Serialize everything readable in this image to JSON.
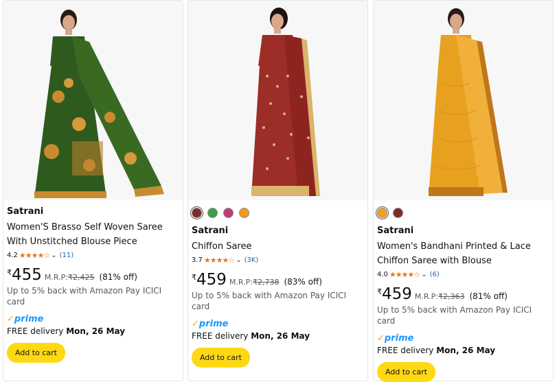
{
  "products": [
    {
      "brand": "Satrani",
      "title_line1": "Women'S Brasso Self Woven Saree",
      "title_line2": "With Unstitched Blouse Piece",
      "rating": "4.2",
      "stars": "★★★★☆",
      "review_count": "(11)",
      "currency": "₹",
      "price": "455",
      "mrp_label": "M.R.P:",
      "mrp": "₹2,425",
      "discount": "(81% off)",
      "cashback": "Up to 5% back with Amazon Pay ICICI card",
      "prime_label": "prime",
      "delivery_prefix": "FREE delivery",
      "delivery_date": "Mon, 26 May",
      "cart_label": "Add to cart",
      "swatches": [],
      "image_colors": [
        "#2f5a1e",
        "#c98b2e"
      ]
    },
    {
      "brand": "Satrani",
      "title_line1": "Chiffon Saree",
      "title_line2": "",
      "rating": "3.7",
      "stars": "★★★★☆",
      "review_count": "(3K)",
      "currency": "₹",
      "price": "459",
      "mrp_label": "M.R.P:",
      "mrp": "₹2,738",
      "discount": "(83% off)",
      "cashback": "Up to 5% back with Amazon Pay ICICI card",
      "prime_label": "prime",
      "delivery_prefix": "FREE delivery",
      "delivery_date": "Mon, 26 May",
      "cart_label": "Add to cart",
      "swatches": [
        "#7b2c2c",
        "#3f9e4d",
        "#c23b77",
        "#f59a1a"
      ],
      "image_colors": [
        "#9c2d27",
        "#d9b46a"
      ]
    },
    {
      "brand": "Satrani",
      "title_line1": "Women's Bandhani Printed & Lace",
      "title_line2": "Chiffon Saree with Blouse",
      "rating": "4.0",
      "stars": "★★★★☆",
      "review_count": "(6)",
      "currency": "₹",
      "price": "459",
      "mrp_label": "M.R.P:",
      "mrp": "₹2,363",
      "discount": "(81% off)",
      "cashback": "Up to 5% back with Amazon Pay ICICI card",
      "prime_label": "prime",
      "delivery_prefix": "FREE delivery",
      "delivery_date": "Mon, 26 May",
      "cart_label": "Add to cart",
      "swatches": [
        "#f0a020",
        "#7b2c2c"
      ],
      "image_colors": [
        "#e8a11f",
        "#c0761a"
      ]
    }
  ]
}
